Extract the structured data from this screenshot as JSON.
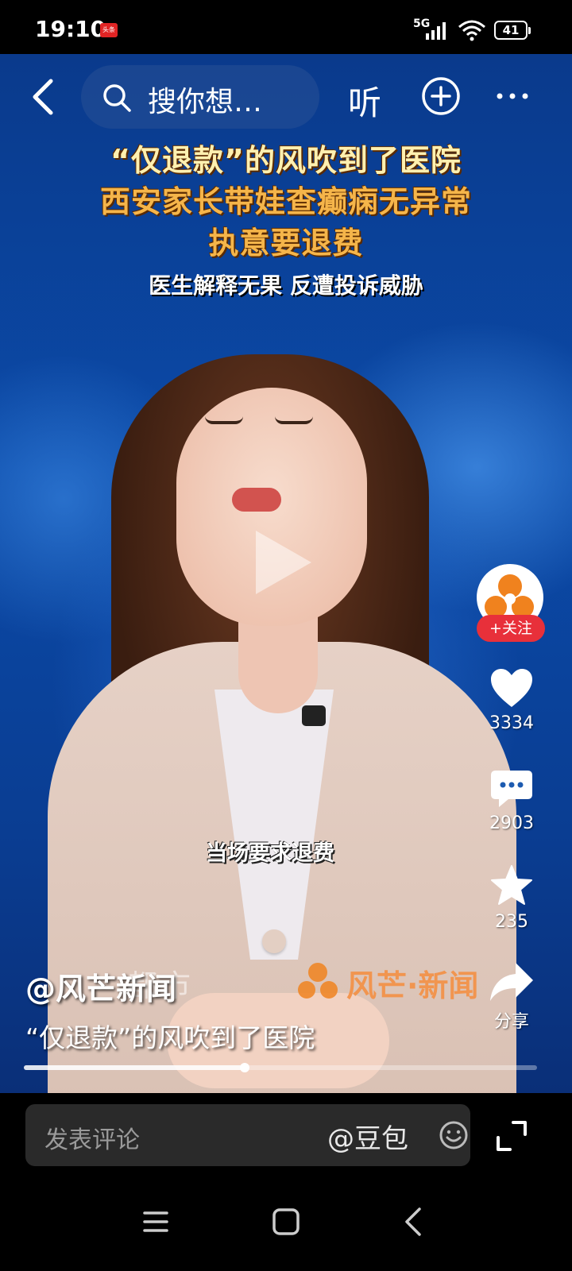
{
  "status_bar": {
    "time": "19:10",
    "app_badge": "头条",
    "network": "5G",
    "battery": "41"
  },
  "top_nav": {
    "search_placeholder": "搜你想…",
    "listen_label": "听"
  },
  "video": {
    "headline_lines": [
      "“仅退款”的风吹到了医院",
      "西安家长带娃查癫痫无异常",
      "执意要退费"
    ],
    "headline_sub": "医生解释无果 反遭投诉威胁",
    "subtitle": "当场要求退费",
    "watermark_text": "都市",
    "watermark_brand": "风芒·新闻",
    "progress_percent": 43
  },
  "sidebar": {
    "follow_label": "+关注",
    "like_count": "3334",
    "comment_count": "2903",
    "favorite_count": "235",
    "share_label": "分享"
  },
  "caption": {
    "author": "@风芒新闻",
    "text": "“仅退款”的风吹到了医院"
  },
  "comment_bar": {
    "placeholder": "发表评论",
    "mention": "@豆包"
  },
  "colors": {
    "follow_red": "#e8303a",
    "headline_orange": "#f5b54a",
    "brand_orange": "#f0821e"
  }
}
